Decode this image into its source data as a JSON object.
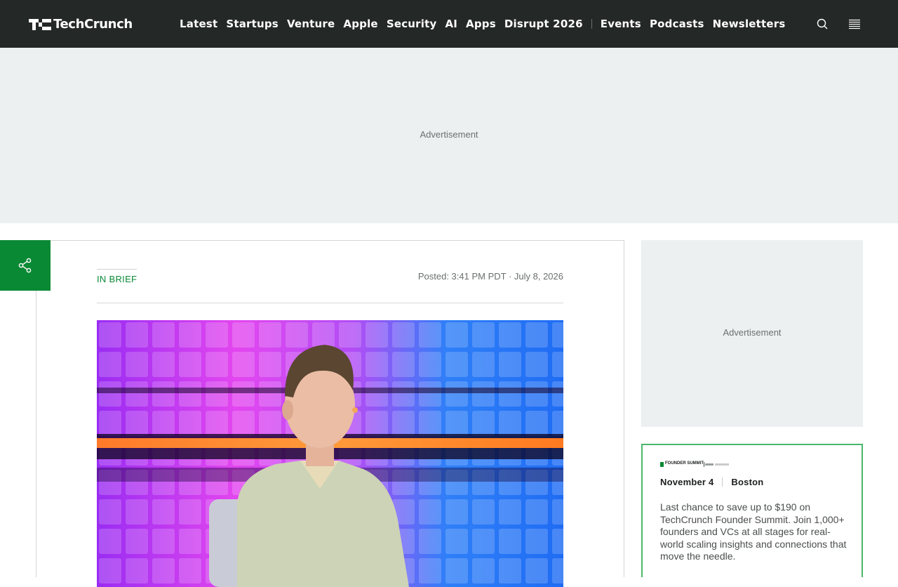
{
  "brand": {
    "name": "TechCrunch",
    "accent": "#0a8935",
    "nav_bg": "#242827"
  },
  "nav": {
    "primary": [
      "Latest",
      "Startups",
      "Venture",
      "Apple",
      "Security",
      "AI",
      "Apps",
      "Disrupt 2026"
    ],
    "secondary": [
      "Events",
      "Podcasts",
      "Newsletters"
    ],
    "icons": [
      "search-icon",
      "menu-icon"
    ]
  },
  "ads": {
    "top_label": "Advertisement",
    "side_label": "Advertisement"
  },
  "article": {
    "kicker": "IN BRIEF",
    "posted": "Posted: 3:41 PM PDT · July 8, 2026",
    "share_icon": "share-icon"
  },
  "event_promo": {
    "logo_text": "FOUNDER SUMMIT",
    "date": "November 4",
    "location": "Boston",
    "description": "Last chance to save up to $190 on TechCrunch Founder Summit. Join 1,000+ founders and VCs at all stages for real-world scaling insights and connections that move the needle."
  }
}
